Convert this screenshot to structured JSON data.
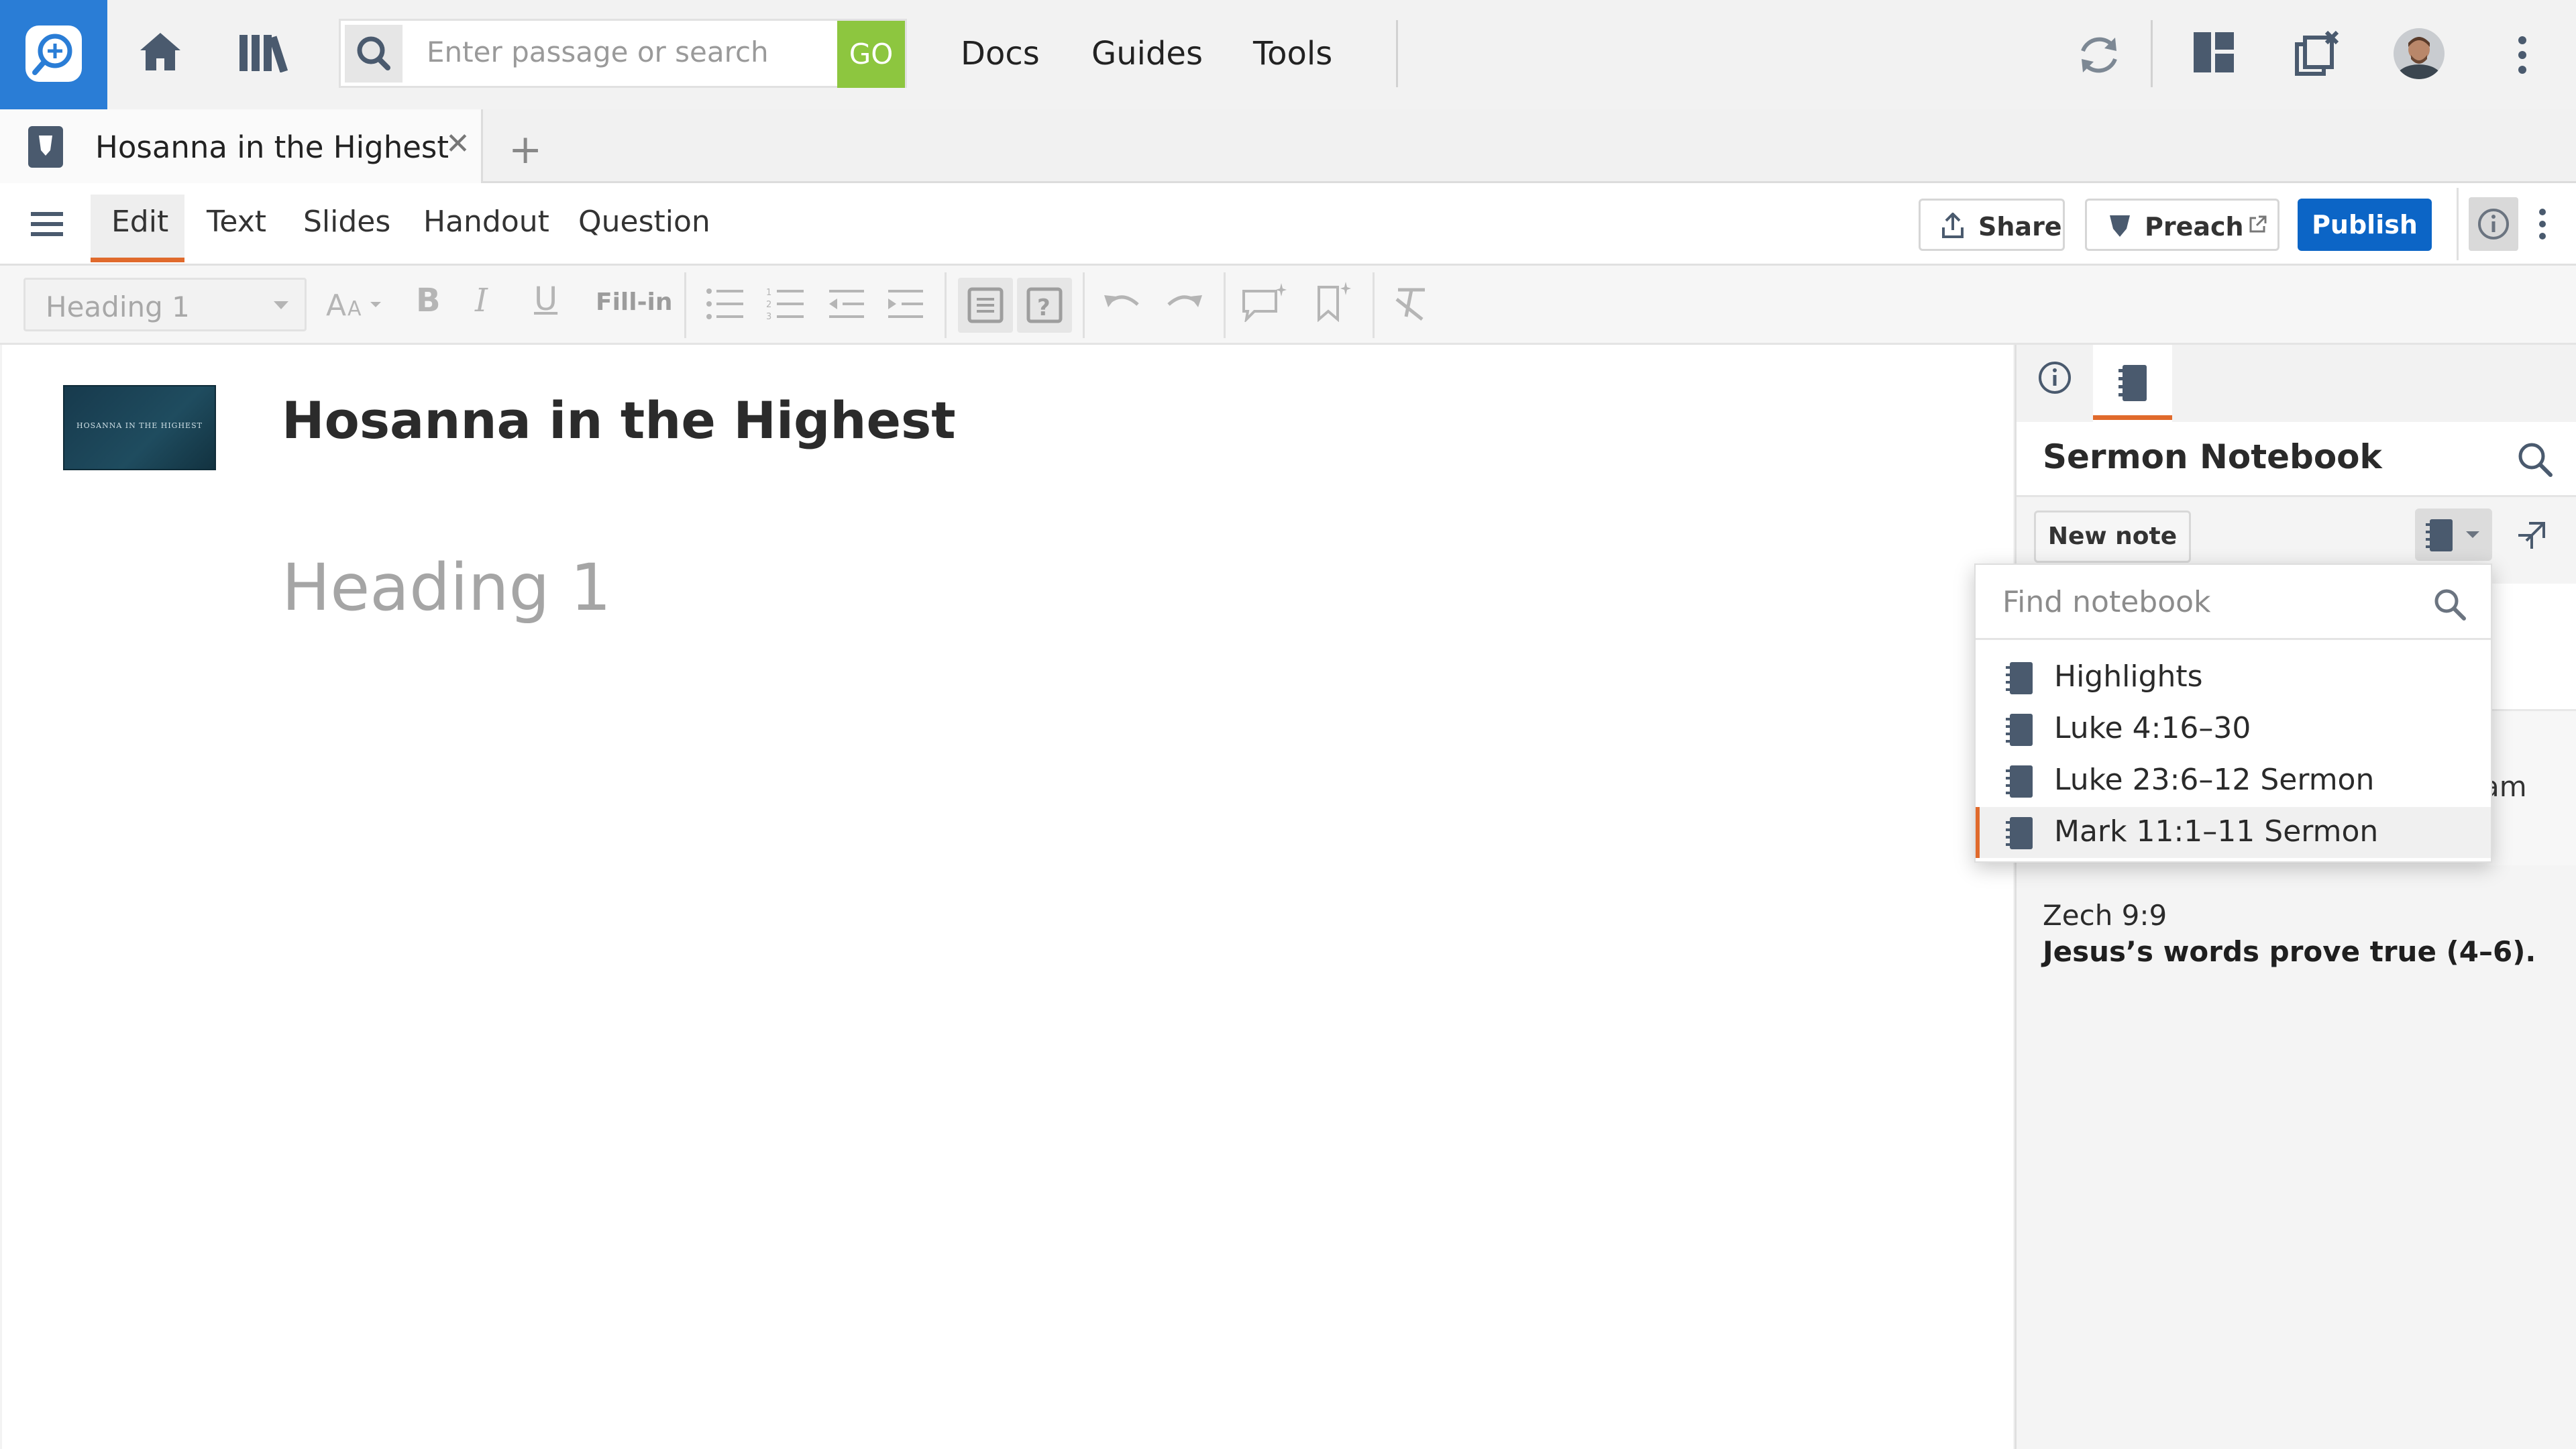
{
  "topbar": {
    "search_placeholder": "Enter passage or search",
    "go_label": "GO",
    "nav": [
      "Docs",
      "Guides",
      "Tools"
    ],
    "icons": [
      "logos-search-logo-icon",
      "home-icon",
      "library-icon",
      "sync-icon",
      "layout-icon",
      "close-panels-icon",
      "user-avatar",
      "more-vertical-icon"
    ]
  },
  "tabs": {
    "doc_tab_title": "Hosanna in the Highest",
    "close_symbol": "✕",
    "add_symbol": "+"
  },
  "modebar": {
    "modes": [
      "Edit",
      "Text",
      "Slides",
      "Handout",
      "Question"
    ],
    "active_mode": "Edit",
    "share_label": "Share",
    "preach_label": "Preach",
    "publish_label": "Publish"
  },
  "format": {
    "style_value": "Heading 1",
    "fill_in_label": "Fill-in"
  },
  "editor": {
    "thumbnail_text": "HOSANNA IN THE HIGHEST",
    "title": "Hosanna in the Highest",
    "heading_placeholder": "Heading 1"
  },
  "panel": {
    "title": "Sermon Notebook",
    "new_note_label": "New note",
    "find_placeholder": "Find notebook",
    "notebooks": [
      "Highlights",
      "Luke 4:16–30",
      "Luke 23:6–12 Sermon",
      "Mark 11:1–11 Sermon"
    ],
    "selected_notebook": "Mark 11:1–11 Sermon",
    "partial_text": "am",
    "note_reference": "Zech 9:9",
    "note_text": "Jesus’s words prove true (4–6)."
  },
  "colors": {
    "logo_blue": "#2a7dd6",
    "go_green": "#8dc63f",
    "publish_blue": "#0c65c6",
    "accent_orange": "#e06a2c"
  }
}
